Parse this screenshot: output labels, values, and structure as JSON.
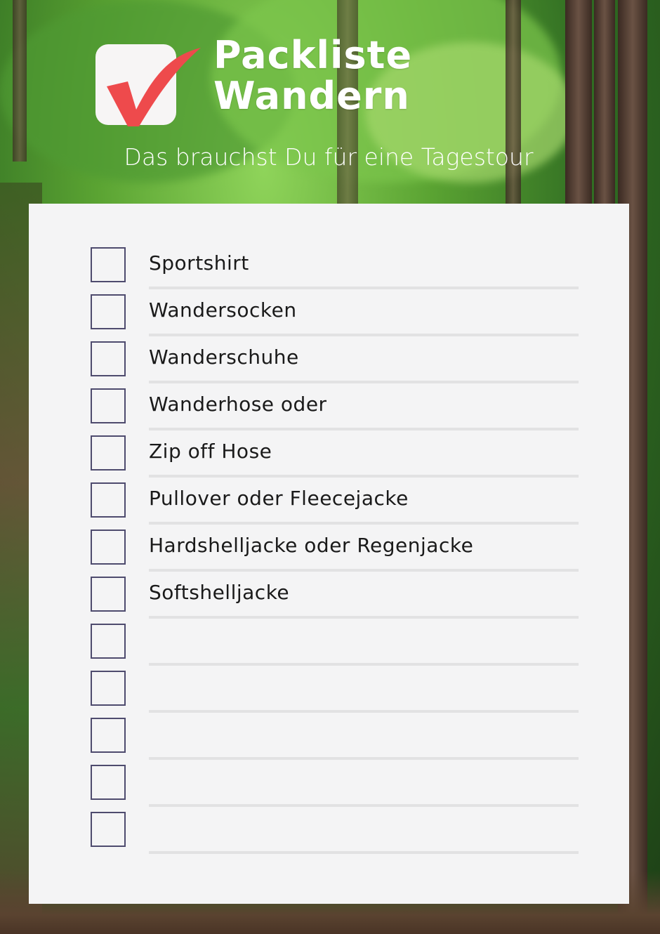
{
  "header": {
    "title_line1": "Packliste",
    "title_line2": "Wandern",
    "subtitle": "Das brauchst Du für eine Tagestour",
    "logo_icon": "checkmark-icon"
  },
  "colors": {
    "checkmark": "#ee4a4c",
    "logo_bg": "#f7f5f5",
    "card_bg": "#f4f4f5",
    "checkbox_border": "#4e4b6e",
    "line": "#e2e2e3",
    "text": "#1a1a1a"
  },
  "checklist": {
    "items": [
      {
        "label": "Sportshirt",
        "checked": false
      },
      {
        "label": "Wandersocken",
        "checked": false
      },
      {
        "label": "Wanderschuhe",
        "checked": false
      },
      {
        "label": "Wanderhose oder",
        "checked": false
      },
      {
        "label": "Zip off Hose",
        "checked": false
      },
      {
        "label": "Pullover oder Fleecejacke",
        "checked": false
      },
      {
        "label": "Hardshelljacke oder Regenjacke",
        "checked": false
      },
      {
        "label": "Softshelljacke",
        "checked": false
      },
      {
        "label": "",
        "checked": false
      },
      {
        "label": "",
        "checked": false
      },
      {
        "label": "",
        "checked": false
      },
      {
        "label": "",
        "checked": false
      },
      {
        "label": "",
        "checked": false
      }
    ]
  }
}
